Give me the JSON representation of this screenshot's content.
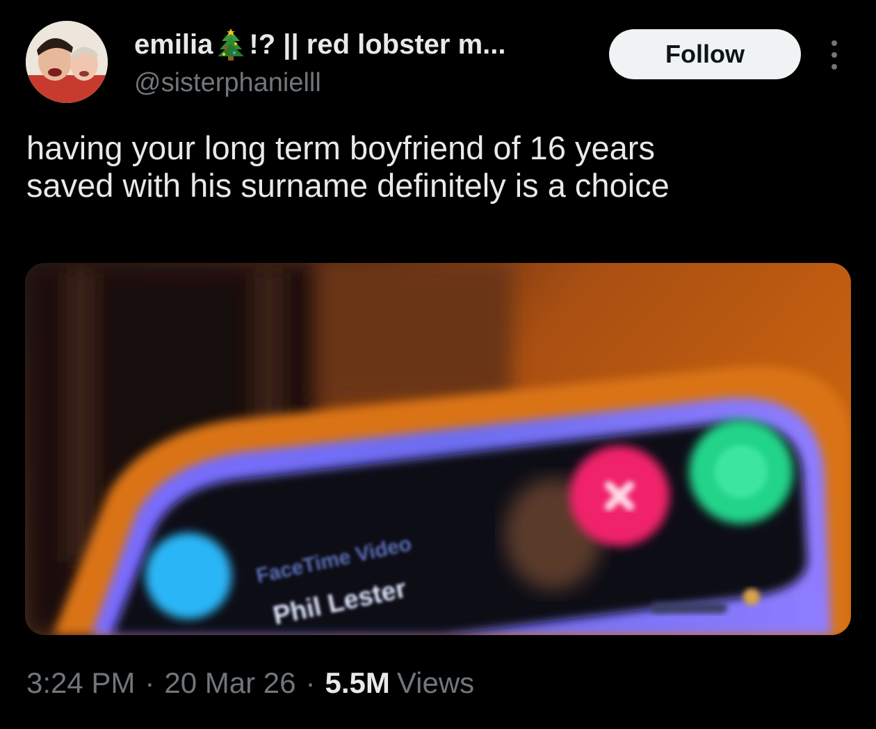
{
  "author": {
    "display_name_prefix": "emilia",
    "display_name_emoji": "christmas-tree-icon",
    "display_name_suffix": "!? || red lobster m...",
    "handle": "@sisterphanielll"
  },
  "actions": {
    "follow_label": "Follow"
  },
  "tweet": {
    "text_lines": [
      "having your long term boyfriend of 16 years",
      "saved with his surname definitely is a choice"
    ]
  },
  "media": {
    "image_alt_icon": "blurred-facetime-call-photo",
    "blurred_caption_lines": [
      "FaceTime Video",
      "Phil Lester"
    ]
  },
  "meta": {
    "time": "3:24 PM",
    "separator": "·",
    "date": "20 Mar 26",
    "views_count": "5.5M",
    "views_label": "Views"
  },
  "colors": {
    "background": "#000000",
    "primary_text": "#e7e9ea",
    "secondary_text": "#71767b",
    "follow_button_bg": "#eff3f4"
  }
}
